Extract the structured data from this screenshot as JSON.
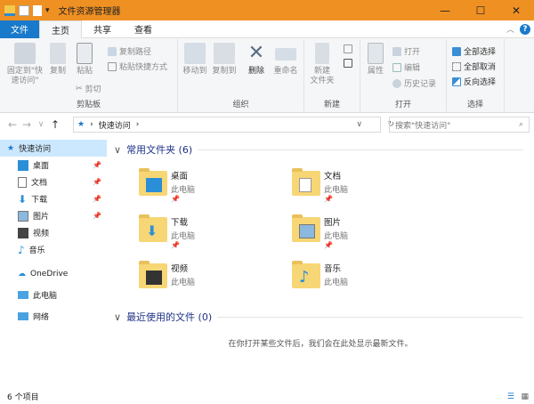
{
  "window": {
    "title": "文件资源管理器"
  },
  "tabs": [
    "文件",
    "主页",
    "共享",
    "查看"
  ],
  "ribbon": {
    "clipboard": {
      "pin": "固定到\"快速访问\"",
      "copy": "复制",
      "paste": "粘贴",
      "copy_path": "复制路径",
      "paste_shortcut": "粘贴快捷方式",
      "cut": "剪切",
      "label": "剪贴板"
    },
    "organize": {
      "move_to": "移动到",
      "copy_to": "复制到",
      "delete": "删除",
      "rename": "重命名",
      "label": "组织"
    },
    "new": {
      "new_folder": "新建\n文件夹",
      "label": "新建"
    },
    "open": {
      "properties": "属性",
      "open": "打开",
      "edit": "编辑",
      "history": "历史记录",
      "label": "打开"
    },
    "select": {
      "select_all": "全部选择",
      "select_none": "全部取消",
      "invert": "反向选择",
      "label": "选择"
    }
  },
  "address": {
    "path": "快速访问",
    "search_placeholder": "搜索\"快速访问\""
  },
  "sidebar": {
    "items": [
      {
        "label": "快速访问",
        "pinned": false
      },
      {
        "label": "桌面",
        "pinned": true
      },
      {
        "label": "文档",
        "pinned": true
      },
      {
        "label": "下载",
        "pinned": true
      },
      {
        "label": "图片",
        "pinned": true
      },
      {
        "label": "视频",
        "pinned": false
      },
      {
        "label": "音乐",
        "pinned": false
      },
      {
        "label": "OneDrive"
      },
      {
        "label": "此电脑"
      },
      {
        "label": "网络"
      }
    ]
  },
  "content": {
    "frequent_header": "常用文件夹 (6)",
    "folders": [
      {
        "name": "桌面",
        "location": "此电脑"
      },
      {
        "name": "文档",
        "location": "此电脑"
      },
      {
        "name": "下载",
        "location": "此电脑"
      },
      {
        "name": "图片",
        "location": "此电脑"
      },
      {
        "name": "视频",
        "location": "此电脑"
      },
      {
        "name": "音乐",
        "location": "此电脑"
      }
    ],
    "recent_header": "最近使用的文件 (0)",
    "recent_empty": "在你打开某些文件后，我们会在此处显示最新文件。"
  },
  "status": {
    "count": "6 个项目"
  },
  "colors": {
    "titlebar": "#ef9023",
    "file_tab": "#1979ca",
    "selected": "#cce8ff"
  }
}
